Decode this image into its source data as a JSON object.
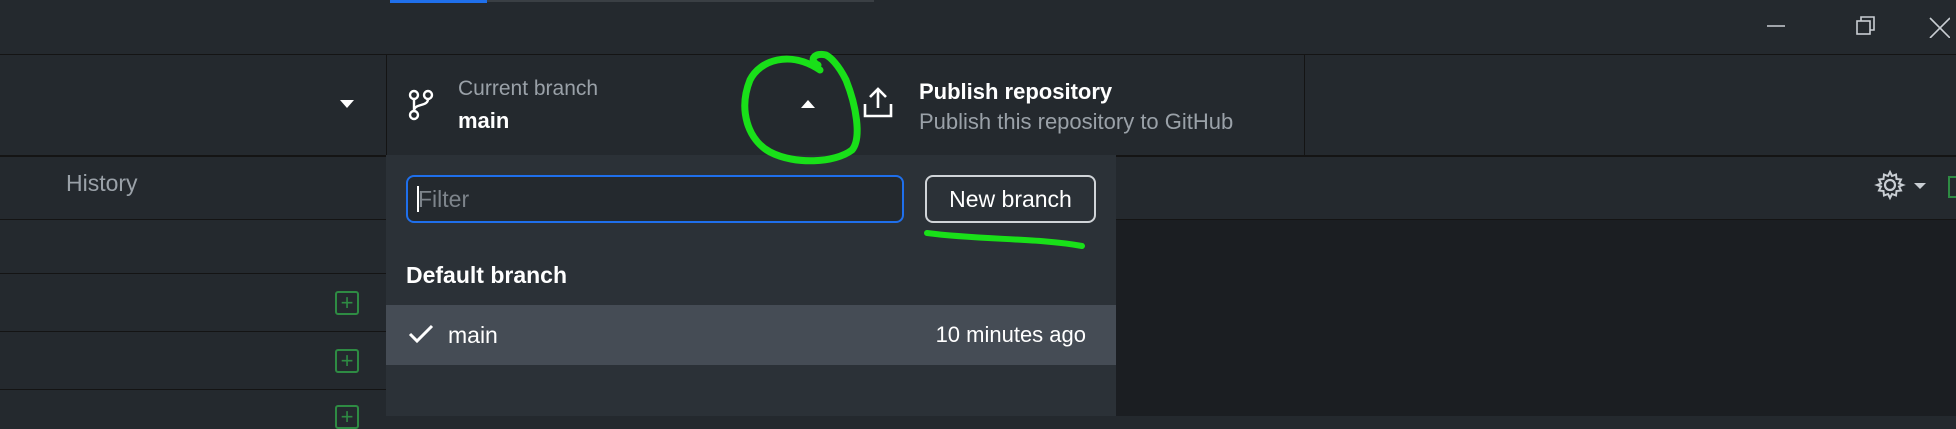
{
  "toolbar": {
    "current_branch_label": "Current branch",
    "current_branch_value": "main",
    "publish_title": "Publish repository",
    "publish_subtitle": "Publish this repository to GitHub"
  },
  "sidebar": {
    "history_tab": "History"
  },
  "branch_dropdown": {
    "filter_placeholder": "Filter",
    "new_branch_label": "New branch",
    "section_default": "Default branch",
    "branches": [
      {
        "name": "main",
        "time": "10 minutes ago",
        "selected": true
      }
    ]
  },
  "colors": {
    "annotation": "#19e019",
    "accent": "#1f6feb",
    "add_green": "#2e8b43"
  },
  "icons": [
    "minimize-icon",
    "restore-icon",
    "close-icon",
    "caret-down-icon",
    "branch-icon",
    "caret-up-icon",
    "upload-icon",
    "gear-icon",
    "check-icon",
    "plus-icon"
  ]
}
